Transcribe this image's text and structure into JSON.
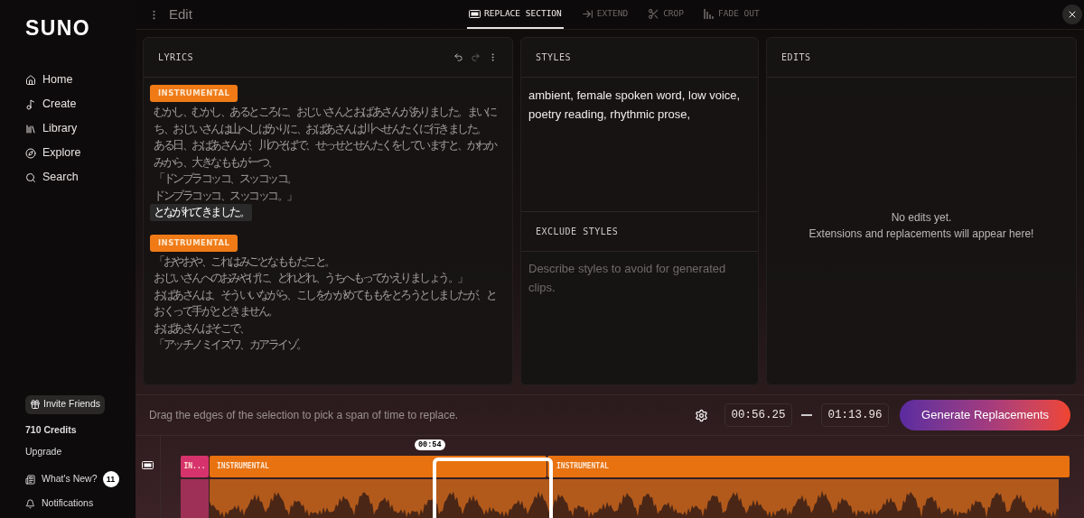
{
  "sidebar": {
    "logo": "SUNO",
    "nav": [
      {
        "label": "Home"
      },
      {
        "label": "Create"
      },
      {
        "label": "Library"
      },
      {
        "label": "Explore"
      },
      {
        "label": "Search"
      }
    ],
    "invite_button": "Invite Friends",
    "credits": "710 Credits",
    "upgrade": "Upgrade",
    "bottom": [
      {
        "label": "What's New?",
        "badge": "11"
      },
      {
        "label": "Notifications"
      }
    ]
  },
  "topbar": {
    "title": "Edit",
    "tabs": [
      {
        "label": "REPLACE SECTION",
        "selected": true
      },
      {
        "label": "EXTEND",
        "selected": false
      },
      {
        "label": "CROP",
        "selected": false
      },
      {
        "label": "FADE OUT",
        "selected": false
      }
    ]
  },
  "lyrics": {
    "title": "LYRICS",
    "sections": [
      {
        "tag": "INSTRUMENTAL",
        "lines": [
          {
            "text": "むかし、むかし、あるところに、おじいさんとおばあさんがありました。まいにち、おじいさんは山へしばかりに、おばあさんは川へせんたくに行きました。",
            "highlighted": false
          },
          {
            "text": "ある日、おばあさんが、川のそばで、せっせとせんたくをしていますと、かわかみから、大きなももが一つ、",
            "highlighted": false
          },
          {
            "text": "「ドンブラコッコ、スッコッコ。",
            "highlighted": false
          },
          {
            "text": "ドンブラコッコ、スッコッコ。」",
            "highlighted": false
          },
          {
            "text": "とながれてきました。",
            "highlighted": true
          }
        ]
      },
      {
        "tag": "INSTRUMENTAL",
        "lines": [
          {
            "text": "「おやおや、これはみごとなももだこと。",
            "highlighted": false
          },
          {
            "text": "おじいさんへのおみやげに、どれどれ、うちへもってかえりましょう。」",
            "highlighted": false
          },
          {
            "text": "おばあさんは、そういいながら、こしをかがめてももをとろうとしましたが、とおくって手がとどきません。",
            "highlighted": false
          },
          {
            "text": "おばあさんはそこで、",
            "highlighted": false
          },
          {
            "text": "「アッチノミイズ ワ、カアライゾ。",
            "highlighted": false
          }
        ]
      }
    ]
  },
  "styles": {
    "title": "STYLES",
    "value": "ambient, female spoken word, low voice, poetry reading, rhythmic prose,"
  },
  "exclude_styles": {
    "title": "EXCLUDE STYLES",
    "placeholder": "Describe styles to avoid for generated clips."
  },
  "edits": {
    "title": "EDITS",
    "empty_title": "No edits yet.",
    "empty_text": "Extensions and replacements will appear here!"
  },
  "selection_bar": {
    "hint": "Drag the edges of the selection to pick a span of time to replace.",
    "start": "00:56.25",
    "end": "01:13.96",
    "button": "Generate Replacements"
  },
  "timeline": {
    "playhead": "00:54",
    "segments": [
      {
        "label": "IN...",
        "color": "#d6336c"
      },
      {
        "label": "INSTRUMENTAL",
        "color": "#e8720f"
      },
      {
        "label": "INSTRUMENTAL",
        "color": "#e8720f"
      }
    ]
  }
}
